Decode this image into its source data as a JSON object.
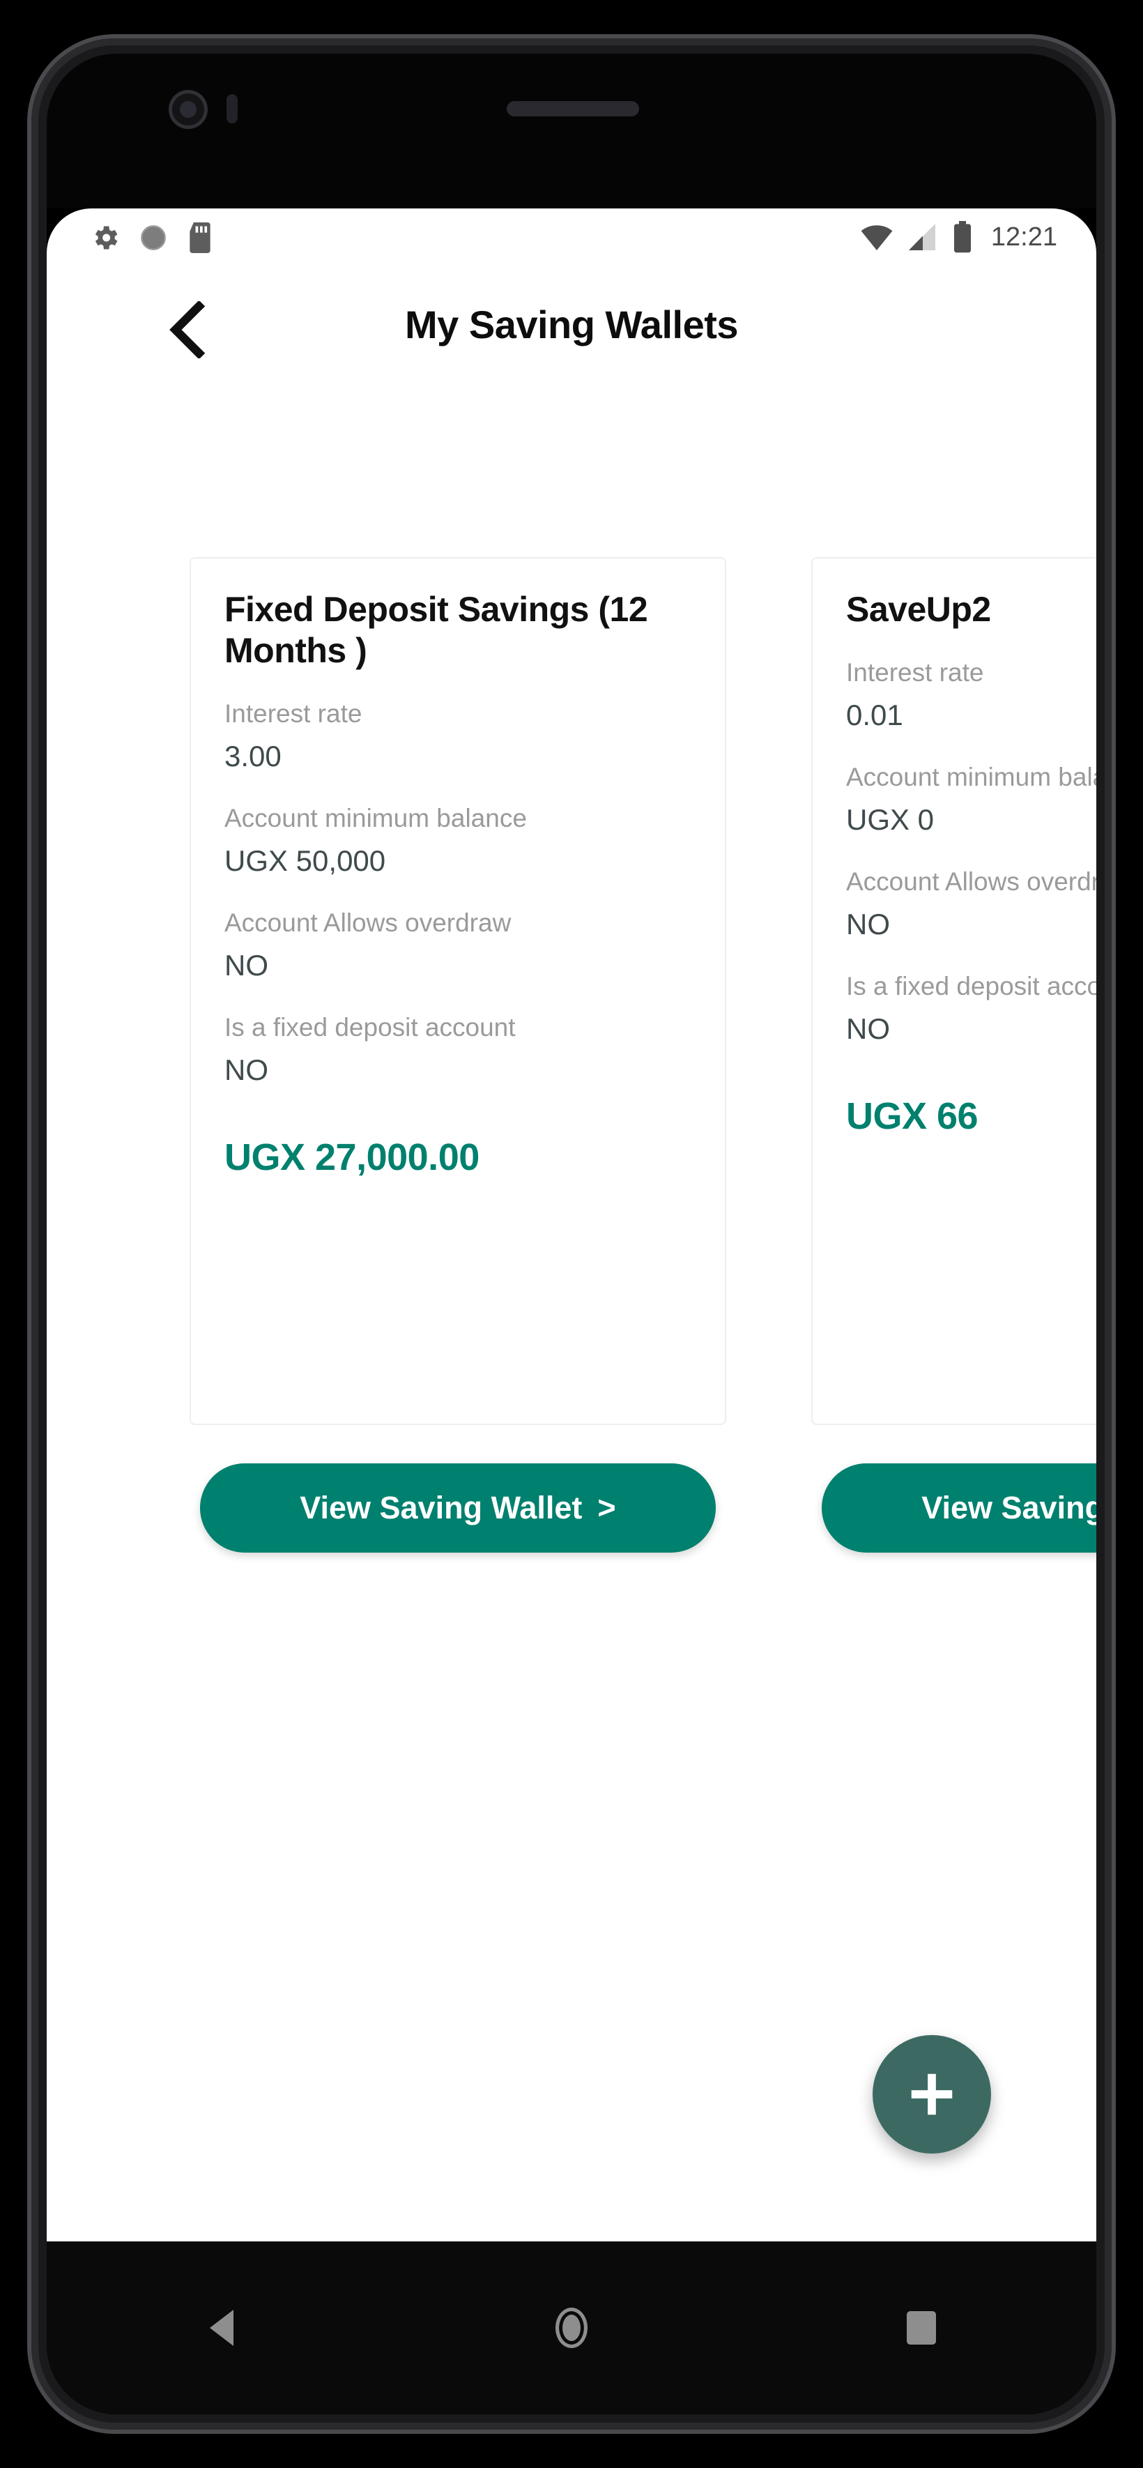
{
  "status_bar": {
    "icons_left": [
      "gear-icon",
      "sync-circle-icon",
      "sd-card-icon"
    ],
    "icons_right": [
      "wifi-icon",
      "cellular-signal-icon",
      "battery-icon"
    ],
    "clock": "12:21"
  },
  "app_bar": {
    "back_icon": "chevron-left-icon",
    "title": "My Saving Wallets"
  },
  "labels": {
    "interest_rate": "Interest rate",
    "minimum_balance": "Account minimum balance",
    "allows_overdraw": "Account Allows overdraw",
    "is_fixed_deposit": "Is a fixed deposit account"
  },
  "wallets": [
    {
      "title": "Fixed Deposit Savings (12 Months )",
      "interest_rate": "3.00",
      "minimum_balance": "UGX 50,000",
      "allows_overdraw": "NO",
      "is_fixed_deposit": "NO",
      "balance": "UGX 27,000.00",
      "button_label": "View Saving Wallet",
      "button_chevron": ">"
    },
    {
      "title": "SaveUp2",
      "interest_rate": "0.01",
      "minimum_balance": "UGX 0",
      "allows_overdraw": "NO",
      "is_fixed_deposit": "NO",
      "balance": "UGX 66",
      "button_label": "View Saving Wallet",
      "button_chevron": ">"
    }
  ],
  "fab": {
    "icon": "plus-icon",
    "label": "Add saving wallet"
  },
  "nav_bar": {
    "back": "back-triangle-icon",
    "home": "home-circle-icon",
    "recents": "recents-square-icon"
  },
  "colors": {
    "accent_teal": "#00806e",
    "fab_teal": "#3c6a62",
    "label_gray": "#9a9a9a",
    "value_gray": "#3f4a4c"
  }
}
